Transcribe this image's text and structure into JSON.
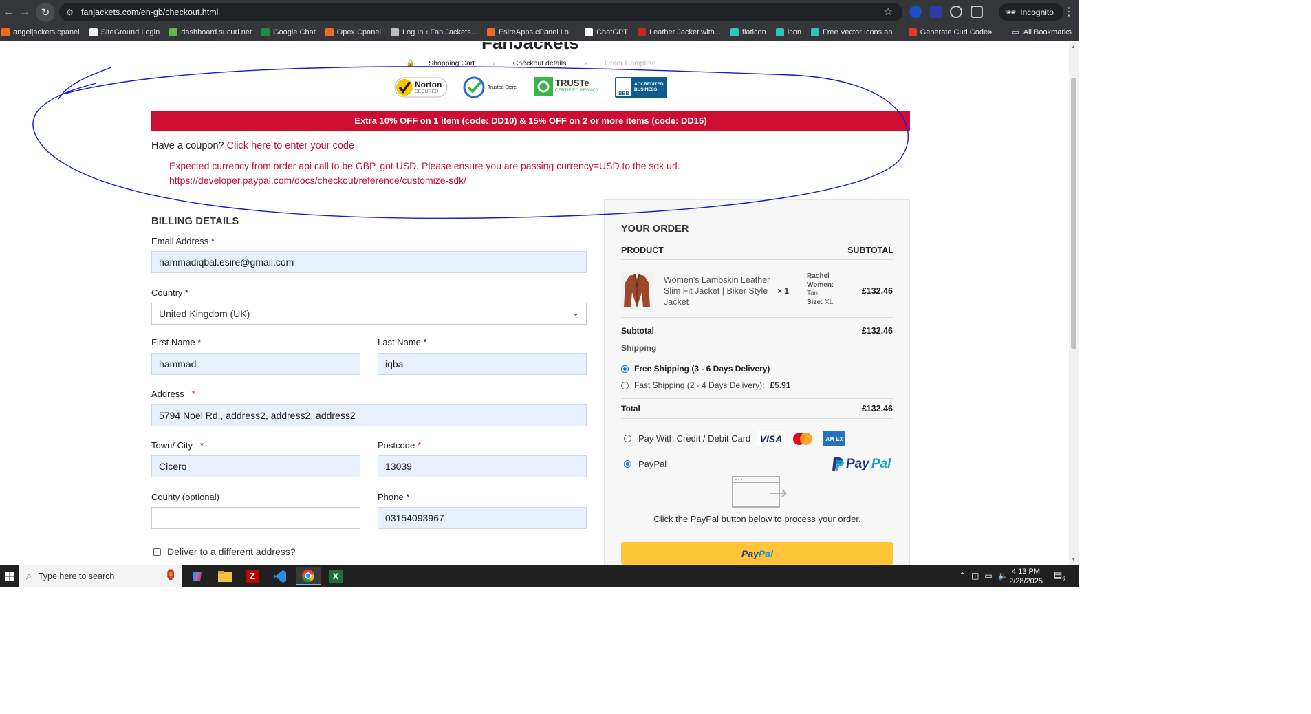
{
  "browser": {
    "url": "fanjackets.com/en-gb/checkout.html",
    "incognito_label": "Incognito",
    "bookmarks": [
      {
        "label": "angeljackets cpanel",
        "color": "#f26b21"
      },
      {
        "label": "SiteGround Login",
        "color": "#f0f0f0"
      },
      {
        "label": "dashboard.sucuri.net",
        "color": "#5dbb46"
      },
      {
        "label": "Google Chat",
        "color": "#1e8e3e"
      },
      {
        "label": "Opex Cpanel",
        "color": "#f26b21"
      },
      {
        "label": "Log In ‹ Fan Jackets...",
        "color": "#bbbbbb"
      },
      {
        "label": "EsireApps cPanel Lo...",
        "color": "#f26b21"
      },
      {
        "label": "ChatGPT",
        "color": "#ffffff"
      },
      {
        "label": "Leather Jacket with...",
        "color": "#c62828"
      },
      {
        "label": "flaticon",
        "color": "#2ec4b6"
      },
      {
        "label": "icon",
        "color": "#2ec4b6"
      },
      {
        "label": "Free Vector Icons an...",
        "color": "#2ec4b6"
      },
      {
        "label": "Generate Curl Code",
        "color": "#e53935"
      }
    ],
    "all_bookmarks": "All Bookmarks"
  },
  "page": {
    "site_title": "FanJackets",
    "steps": [
      "Shopping Cart",
      "Checkout details",
      "Order Complete"
    ],
    "trust_badges": {
      "norton": "Norton",
      "norton_sub": "SECURED",
      "trusted_store": "Trusted Store",
      "truste": "TRUSTe",
      "truste_sub": "CERTIFIED PRIVACY",
      "bbb_1": "ACCREDITED",
      "bbb_2": "BUSINESS",
      "bbb_logo": "BBB"
    },
    "promo_text": "Extra 10% OFF on 1 item (code: DD10) & 15% OFF on 2 or more items (code: DD15)",
    "coupon_prompt": "Have a coupon?",
    "coupon_link": "Click here to enter your code",
    "error_line1": "Expected currency from order api call to be GBP, got USD. Please ensure you are passing currency=USD to the sdk url.",
    "error_line2": "https://developer.paypal.com/docs/checkout/reference/customize-sdk/",
    "billing": {
      "title": "BILLING DETAILS",
      "email_label": "Email Address",
      "email_value": "hammadiqbal.esire@gmail.com",
      "country_label": "Country",
      "country_value": "United Kingdom (UK)",
      "first_name_label": "First Name",
      "first_name_value": "hammad",
      "last_name_label": "Last Name",
      "last_name_value": "iqba",
      "address_label": "Address",
      "address_value": "5794 Noel Rd., address2, address2, address2",
      "town_label": "Town/ City",
      "town_value": "Cicero",
      "postcode_label": "Postcode",
      "postcode_value": "13039",
      "county_label": "County (optional)",
      "county_value": "",
      "phone_label": "Phone",
      "phone_value": "03154093967",
      "deliver_label": "Deliver to a different address?",
      "required_mark": "*"
    },
    "order": {
      "title": "YOUR ORDER",
      "col_product": "PRODUCT",
      "col_subtotal": "SUBTOTAL",
      "product_name": "Women's Lambskin Leather Slim Fit Jacket | Biker Style Jacket",
      "quantity": "× 1",
      "attr_name_label": "Rachel Women:",
      "attr_name_value": "Tan",
      "attr_size_label": "Size:",
      "attr_size_value": "XL",
      "line_price": "£132.46",
      "subtotal_label": "Subtotal",
      "subtotal_value": "£132.46",
      "shipping_label": "Shipping",
      "shipping_options": [
        {
          "label": "Free Shipping (3 - 6 Days Delivery)",
          "selected": true
        },
        {
          "label": "Fast Shipping (2 - 4 Days Delivery):",
          "price": "£5.91",
          "selected": false
        }
      ],
      "total_label": "Total",
      "total_value": "£132.46",
      "pay_card_label": "Pay With Credit / Debit Card",
      "card_visa": "VISA",
      "card_amex": "AM EX",
      "pay_paypal_label": "PayPal",
      "paypal_logo_1": "Pay",
      "paypal_logo_2": "Pal",
      "redirect_note": "Click the PayPal button below to process your order.",
      "paypal_button_1": "Pay",
      "paypal_button_2": "Pal"
    }
  },
  "taskbar": {
    "search_placeholder": "Type here to search",
    "time": "4:13 PM",
    "date": "2/28/2025",
    "notification_count": "6"
  },
  "colors": {
    "accent_red": "#cc0e32",
    "paypal_yellow": "#ffc439",
    "paypal_navy": "#253b80",
    "paypal_blue": "#179bd7",
    "annotation_blue": "#1a1ad0"
  }
}
